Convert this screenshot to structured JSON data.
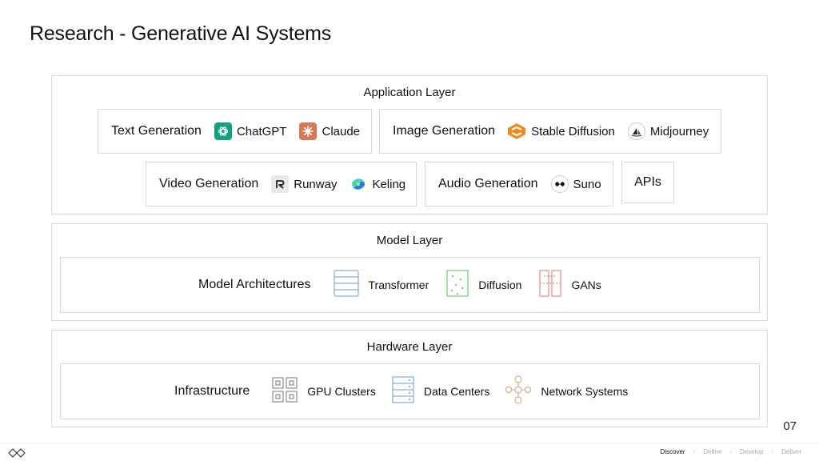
{
  "title": "Research - Generative AI Systems",
  "page_number": "07",
  "application_layer": {
    "title": "Application Layer",
    "text_generation": {
      "label": "Text Generation",
      "tools": [
        "ChatGPT",
        "Claude"
      ]
    },
    "image_generation": {
      "label": "Image Generation",
      "tools": [
        "Stable Diffusion",
        "Midjourney"
      ]
    },
    "video_generation": {
      "label": "Video Generation",
      "tools": [
        "Runway",
        "Keling"
      ]
    },
    "audio_generation": {
      "label": "Audio Generation",
      "tools": [
        "Suno"
      ]
    },
    "apis": "APIs"
  },
  "model_layer": {
    "title": "Model Layer",
    "category": "Model Architectures",
    "items": [
      "Transformer",
      "Diffusion",
      "GANs"
    ]
  },
  "hardware_layer": {
    "title": "Hardware Layer",
    "category": "Infrastructure",
    "items": [
      "GPU Clusters",
      "Data Centers",
      "Network Systems"
    ]
  },
  "footer_nav": {
    "steps": [
      "Discover",
      "Define",
      "Develop",
      "Deliver"
    ],
    "active": "Discover"
  },
  "colors": {
    "chatgpt": "#10a37f",
    "claude": "#d97757",
    "stable_diffusion": "#f08c1e",
    "transformer": "#6b9bd1",
    "diffusion": "#5cb85c",
    "gans": "#e57373"
  }
}
